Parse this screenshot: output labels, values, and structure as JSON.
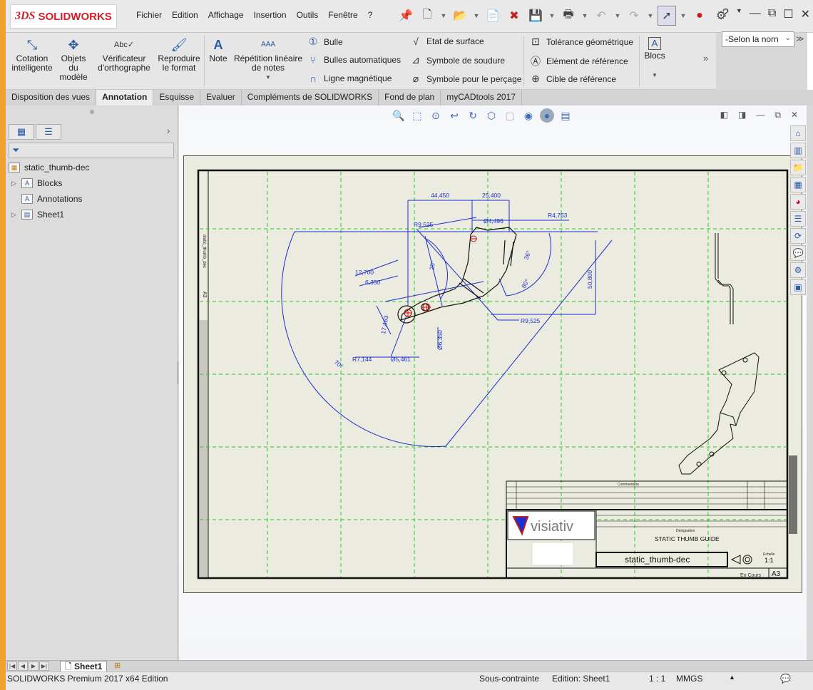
{
  "app": {
    "logo_mark": "3DS",
    "logo_text": "SOLIDWORKS"
  },
  "menu": [
    "Fichier",
    "Edition",
    "Affichage",
    "Insertion",
    "Outils",
    "Fenêtre",
    "?"
  ],
  "title_right": {
    "selector_label": "-Selon la norn"
  },
  "ribbon": {
    "cotation": "Cotation intelligente",
    "objets": "Objets du modèle",
    "verificateur": "Vérificateur d'orthographe",
    "reproduire": "Reproduire le format",
    "note": "Note",
    "repetition": "Répétition linéaire de notes",
    "bulle": "Bulle",
    "bulles_auto": "Bulles automatiques",
    "ligne_mag": "Ligne magnétique",
    "etat_surface": "Etat de surface",
    "symbole_soudure": "Symbole de soudure",
    "symbole_percage": "Symbole pour le perçage",
    "tolerance": "Tolérance géométrique",
    "element_ref": "Elément de référence",
    "cible_ref": "Cible de référence",
    "blocs": "Blocs"
  },
  "tabs": [
    "Disposition des vues",
    "Annotation",
    "Esquisse",
    "Evaluer",
    "Compléments de SOLIDWORKS",
    "Fond de plan",
    "myCADtools 2017"
  ],
  "active_tab": "Annotation",
  "tree": {
    "root": "static_thumb-dec",
    "items": [
      "Blocks",
      "Annotations",
      "Sheet1"
    ]
  },
  "drawing": {
    "dims": [
      "44,450",
      "25,400",
      "Ø4,496",
      "R4,763",
      "R9,525",
      "12,700",
      "6,350",
      "20°",
      "36°",
      "80°",
      "50,800",
      "R9,525",
      "17,463",
      "Ø6,350",
      "R7,144",
      "Ø5,461",
      "70°"
    ],
    "title_block": {
      "company": "visiativ",
      "designation_label": "Désignation",
      "designation": "STATIC THUMB GUIDE",
      "filename": "static_thumb-dec",
      "scale_label": "Echelle",
      "scale": "1:1",
      "size": "A3",
      "revision_header": "Commentaire",
      "status": "En Cours",
      "side_label": "static_thumb_dec",
      "side_size": "A3"
    }
  },
  "sheet_tab": "Sheet1",
  "status": {
    "edition": "SOLIDWORKS Premium 2017 x64 Edition",
    "constraint": "Sous-contrainte",
    "editing": "Edition: Sheet1",
    "scale": "1 : 1",
    "units": "MMGS"
  }
}
